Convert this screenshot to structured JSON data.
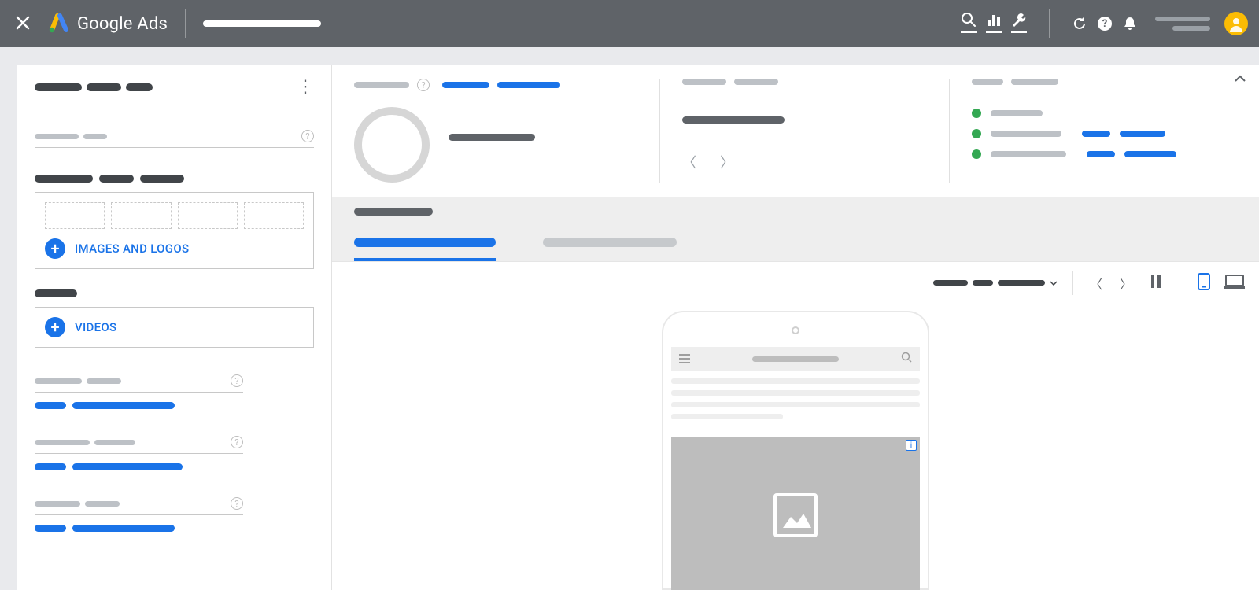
{
  "header": {
    "brand": "Google Ads"
  },
  "left_panel": {
    "add_images_label": "IMAGES AND LOGOS",
    "add_videos_label": "VIDEOS"
  }
}
